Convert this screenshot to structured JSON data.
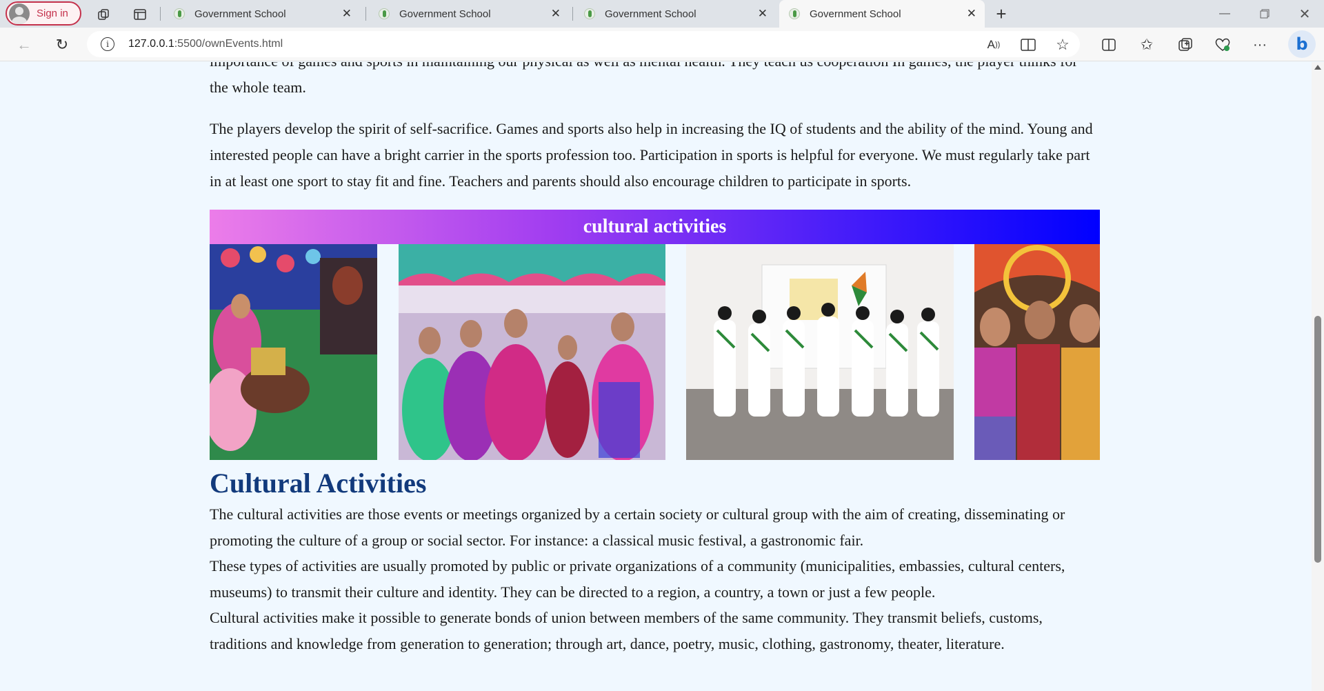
{
  "browser": {
    "signin_label": "Sign in",
    "tabs": [
      {
        "title": "Government School"
      },
      {
        "title": "Government School"
      },
      {
        "title": "Government School"
      },
      {
        "title": "Government School"
      }
    ],
    "url_host": "127.0.0.1",
    "url_rest": ":5500/ownEvents.html",
    "icons": [
      "workspaces-icon",
      "tab-actions-icon",
      "new-tab-icon",
      "minimize-icon",
      "restore-icon",
      "close-window-icon",
      "back-icon",
      "refresh-icon",
      "site-info-icon",
      "read-aloud-icon",
      "immersive-reader-icon",
      "favorite-star-icon",
      "split-screen-icon",
      "favorites-icon",
      "collections-icon",
      "browser-essentials-icon",
      "more-menu-icon",
      "bing-copilot-icon"
    ]
  },
  "page": {
    "sports_para_end": "importance of games and sports in maintaining our physical as well as mental health. They teach us cooperation In games, the player thinks for the whole team.",
    "sports_para_2": "The players develop the spirit of self-sacrifice. Games and sports also help in increasing the IQ of students and the ability of the mind. Young and interested people can have a bright carrier in the sports profession too. Participation in sports is helpful for everyone. We must regularly take part in at least one sport to stay fit and fine. Teachers and parents should also encourage children to participate in sports.",
    "banner_title": "cultural activities",
    "section_title": "Cultural Activities",
    "cultural_p1": "The cultural activities are those events or meetings organized by a certain society or cultural group with the aim of creating, disseminating or promoting the culture of a group or social sector. For instance: a classical music festival, a gastronomic fair.",
    "cultural_p2": "These types of activities are usually promoted by public or private organizations of a community (municipalities, embassies, cultural centers, museums) to transmit their culture and identity. They can be directed to a region, a country, a town or just a few people.",
    "cultural_p3": "Cultural activities make it possible to generate bonds of union between members of the same community. They transmit beliefs, customs, traditions and knowledge from generation to generation; through art, dance, poetry, music, clothing, gastronomy, theater, literature."
  },
  "colors": {
    "page_bg": "#f0f8ff",
    "heading": "#123a7c",
    "banner_gradient": [
      "#ec7de9",
      "#a23ef0",
      "#4a1ef9",
      "#0000ff"
    ]
  }
}
